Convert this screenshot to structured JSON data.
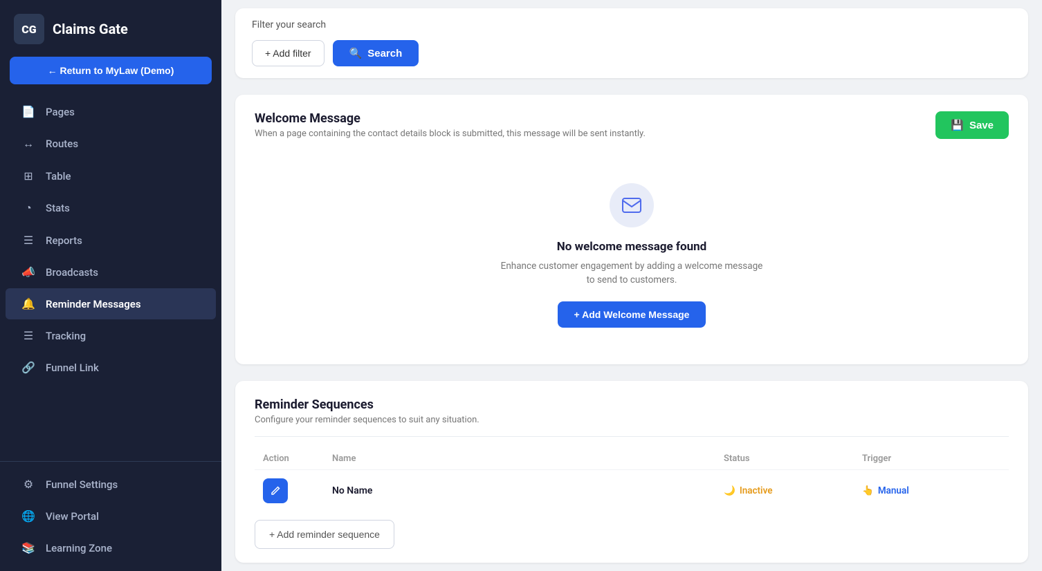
{
  "app": {
    "logo_initials": "CG",
    "logo_name": "Claims Gate"
  },
  "sidebar": {
    "return_button": "← Return to MyLaw (Demo)",
    "items": [
      {
        "id": "pages",
        "label": "Pages",
        "icon": "📄",
        "active": false
      },
      {
        "id": "routes",
        "label": "Routes",
        "icon": "↔",
        "active": false
      },
      {
        "id": "table",
        "label": "Table",
        "icon": "⊞",
        "active": false
      },
      {
        "id": "stats",
        "label": "Stats",
        "icon": "◔",
        "active": false
      },
      {
        "id": "reports",
        "label": "Reports",
        "icon": "☰",
        "active": false
      },
      {
        "id": "broadcasts",
        "label": "Broadcasts",
        "icon": "📣",
        "active": false
      },
      {
        "id": "reminder-messages",
        "label": "Reminder Messages",
        "icon": "🔔",
        "active": true
      },
      {
        "id": "tracking",
        "label": "Tracking",
        "icon": "☰",
        "active": false
      },
      {
        "id": "funnel-link",
        "label": "Funnel Link",
        "icon": "🔗",
        "active": false
      }
    ],
    "bottom_items": [
      {
        "id": "funnel-settings",
        "label": "Funnel Settings",
        "icon": "⚙"
      },
      {
        "id": "view-portal",
        "label": "View Portal",
        "icon": "🌐"
      },
      {
        "id": "learning-zone",
        "label": "Learning Zone",
        "icon": "📚"
      }
    ]
  },
  "filter": {
    "title": "Filter your search",
    "add_filter_label": "+ Add filter",
    "search_label": "Search"
  },
  "welcome_message": {
    "title": "Welcome Message",
    "subtitle": "When a page containing the contact details block is submitted, this message will be sent instantly.",
    "save_label": "Save",
    "empty_title": "No welcome message found",
    "empty_desc": "Enhance customer engagement by adding a welcome message to send to customers.",
    "add_button": "+ Add Welcome Message"
  },
  "reminder_sequences": {
    "title": "Reminder Sequences",
    "subtitle": "Configure your reminder sequences to suit any situation.",
    "table_headers": [
      "Action",
      "Name",
      "Status",
      "Trigger"
    ],
    "rows": [
      {
        "name": "No Name",
        "status": "Inactive",
        "trigger": "Manual"
      }
    ],
    "add_button": "+ Add reminder sequence"
  }
}
